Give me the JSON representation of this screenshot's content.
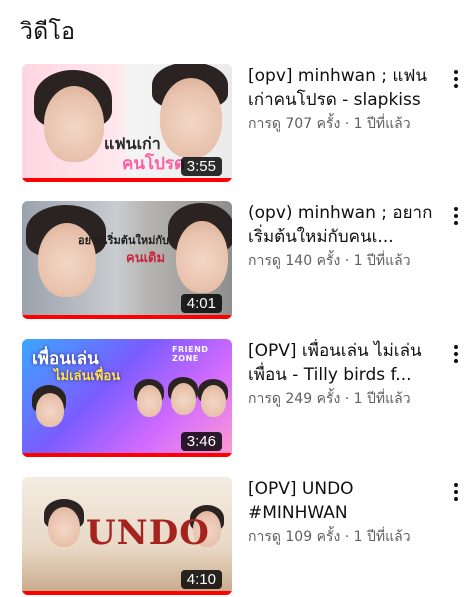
{
  "section": {
    "title": "วิดีโอ"
  },
  "videos": [
    {
      "title": "[opv] minhwan ; แฟนเก่าคนโปรด - slapkiss",
      "meta": "การดู 707 ครั้ง · 1 ปีที่แล้ว",
      "duration": "3:55",
      "thumb_text_1": "แฟนเก่า",
      "thumb_text_2": "คนโปรด",
      "watched_fraction": 1.0
    },
    {
      "title": "(opv) minhwan ; อยากเริ่มต้นใหม่กับคนเ...",
      "meta": "การดู 140 ครั้ง · 1 ปีที่แล้ว",
      "duration": "4:01",
      "thumb_text_1": "อยากเริ่มต้นใหม่กับ",
      "thumb_text_2": "คนเดิม",
      "watched_fraction": 1.0
    },
    {
      "title": "[OPV] เพื่อนเล่น ไม่เล่นเพื่อน - Tilly birds f...",
      "meta": "การดู 249 ครั้ง · 1 ปีที่แล้ว",
      "duration": "3:46",
      "thumb_text_1": "เพื่อนเล่น",
      "thumb_text_2": "ไม่เล่นเพื่อน",
      "thumb_text_3": "FRIEND ZONE",
      "watched_fraction": 1.0
    },
    {
      "title": "[OPV] UNDO #MINHWAN",
      "meta": "การดู 109 ครั้ง · 1 ปีที่แล้ว",
      "duration": "4:10",
      "thumb_text_1": "UNDO",
      "watched_fraction": 1.0
    }
  ],
  "colors": {
    "progress": "#ff0000",
    "meta_text": "#606060",
    "title_text": "#0f0f0f"
  },
  "icons": {
    "more": "more-vert-icon"
  }
}
